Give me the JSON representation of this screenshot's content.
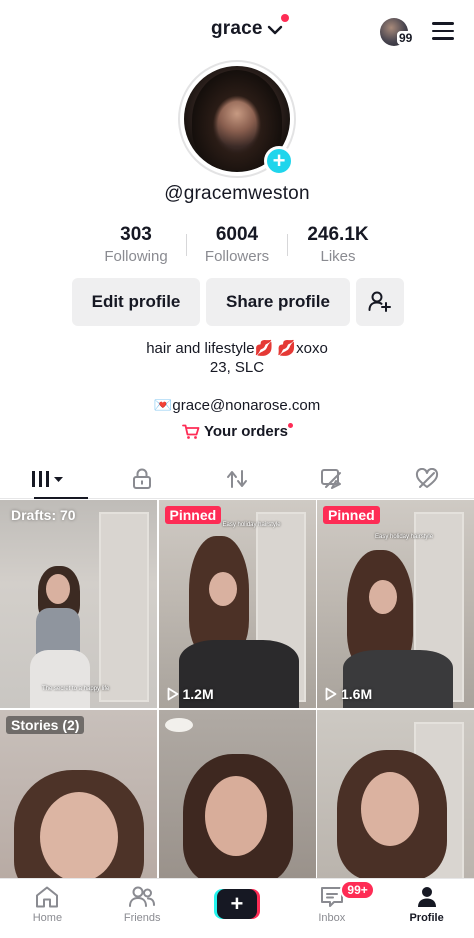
{
  "header": {
    "username": "grace",
    "story_count": "99"
  },
  "profile": {
    "handle": "@gracemweston",
    "stats": [
      {
        "value": "303",
        "label": "Following"
      },
      {
        "value": "6004",
        "label": "Followers"
      },
      {
        "value": "246.1K",
        "label": "Likes"
      }
    ],
    "edit_label": "Edit profile",
    "share_label": "Share profile",
    "bio_line1": "hair and lifestyle💋 💋xoxo",
    "bio_line2": "23, SLC",
    "email": "💌grace@nonarose.com",
    "orders_label": "Your orders"
  },
  "tabs": [
    "videos-grid-icon",
    "lock-icon",
    "repost-icon",
    "tagged-icon",
    "liked-icon"
  ],
  "grid": [
    {
      "badge": "Drafts: 70",
      "overlay": "The secret to a happy life",
      "views": ""
    },
    {
      "badge": "Pinned",
      "overlay": "Easy holiday hairstyle",
      "views": "1.2M"
    },
    {
      "badge": "Pinned",
      "overlay": "Easy holiday hairstyle",
      "views": "1.6M"
    },
    {
      "badge": "Stories (2)",
      "overlay": "",
      "views": ""
    },
    {
      "badge": "",
      "overlay": "",
      "views": ""
    },
    {
      "badge": "",
      "overlay": "",
      "views": ""
    }
  ],
  "nav": {
    "home": "Home",
    "friends": "Friends",
    "inbox": "Inbox",
    "inbox_badge": "99+",
    "profile": "Profile"
  },
  "colors": {
    "accent": "#fe2c55",
    "teal": "#20d5ec",
    "text": "#161823",
    "muted": "#8a8b91"
  }
}
